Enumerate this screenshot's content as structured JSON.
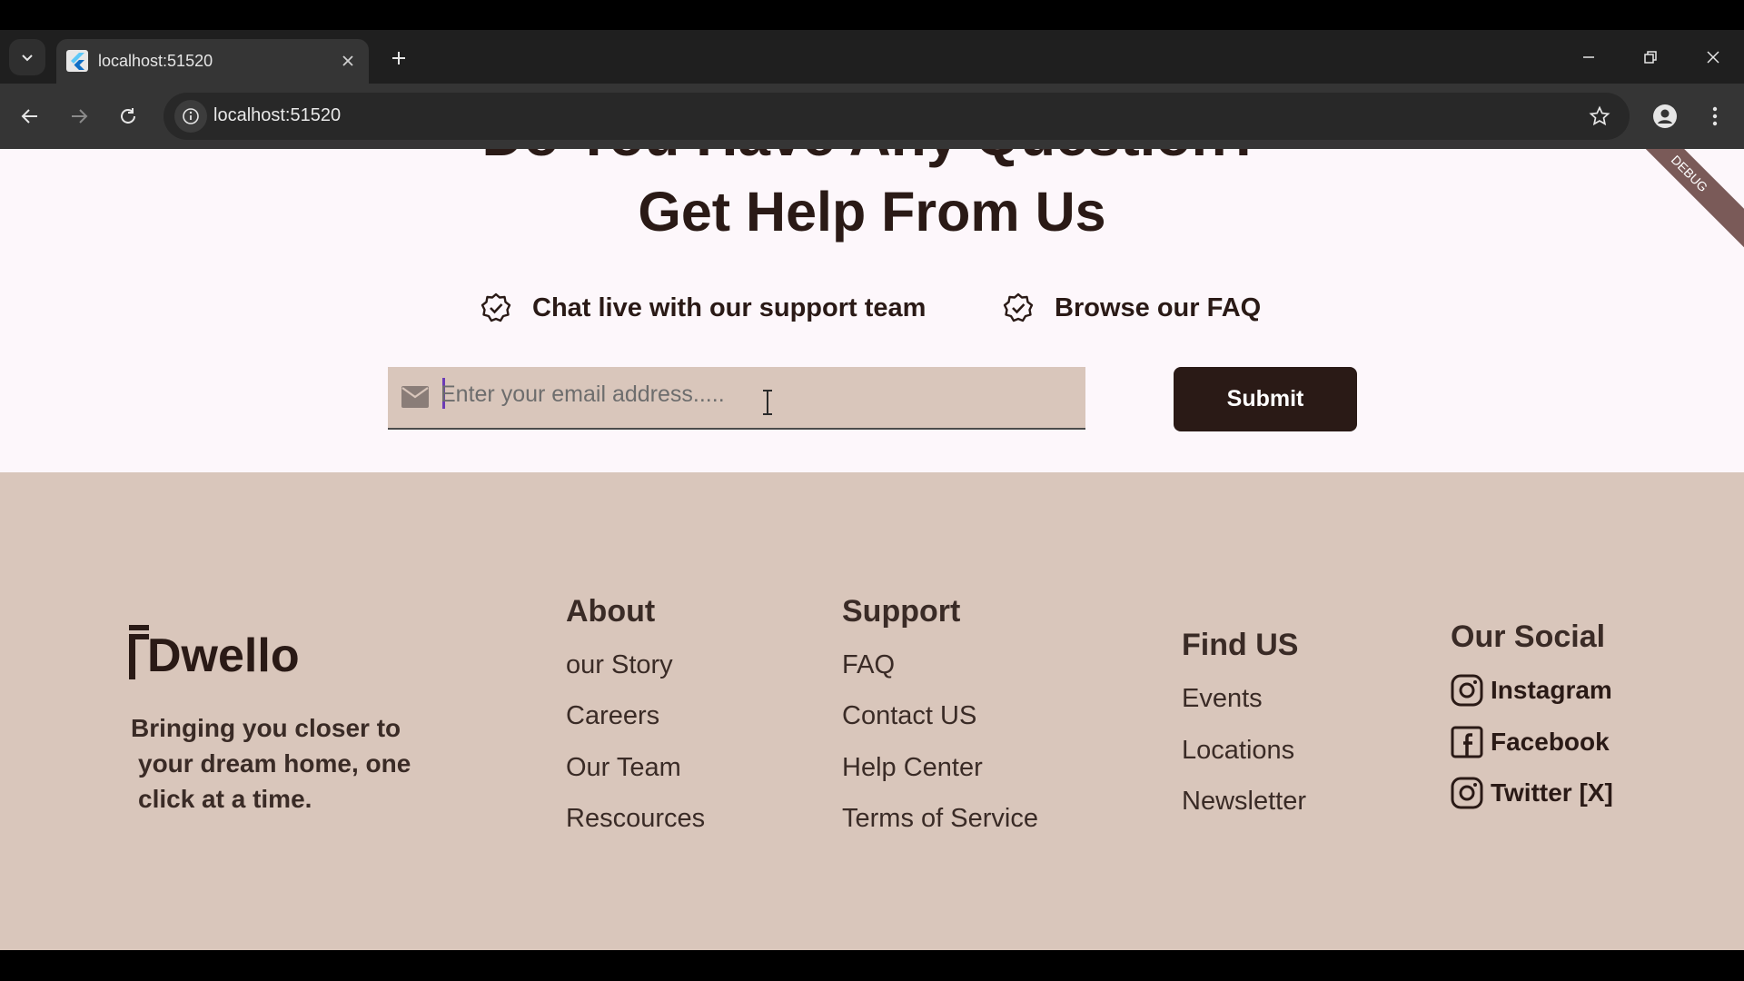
{
  "browser": {
    "tab_title": "localhost:51520",
    "url": "localhost:51520"
  },
  "hero": {
    "heading_cut": "Do You Have Any Question?",
    "heading": "Get Help From Us",
    "features": [
      "Chat live with our support team",
      "Browse our FAQ"
    ],
    "email_placeholder": "Enter your email address.....",
    "email_value": "",
    "submit_label": "Submit",
    "debug_label": "DEBUG"
  },
  "footer": {
    "logo_text": "Dwello",
    "tagline": [
      "Bringing you closer to",
      "your dream home, one",
      "click at a time."
    ],
    "about": {
      "title": "About",
      "links": [
        "our Story",
        "Careers",
        "Our Team",
        "Rescources"
      ]
    },
    "support": {
      "title": "Support",
      "links": [
        "FAQ",
        "Contact US",
        "Help Center",
        "Terms of Service"
      ]
    },
    "find_us": {
      "title": "Find US",
      "links": [
        "Events",
        "Locations",
        "Newsletter"
      ]
    },
    "social": {
      "title": "Our Social",
      "links": [
        {
          "label": "Instagram",
          "icon": "instagram-icon"
        },
        {
          "label": "Facebook",
          "icon": "facebook-icon"
        },
        {
          "label": "Twitter [X]",
          "icon": "instagram-icon"
        }
      ]
    }
  },
  "colors": {
    "brand_dark": "#2a1a16",
    "footer_bg": "#d9c6bb",
    "page_bg": "#fdf7fb",
    "input_bg": "#d9c6bb"
  }
}
